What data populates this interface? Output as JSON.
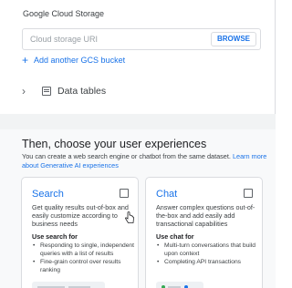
{
  "gcs": {
    "section_label": "Google Cloud Storage",
    "uri_placeholder": "Cloud storage URI",
    "browse_label": "BROWSE",
    "add_bucket_label": "Add another GCS bucket",
    "add_icon": "plus-icon"
  },
  "data_tables": {
    "label": "Data tables",
    "expand_icon": "chevron-right-icon",
    "table_icon": "table-icon"
  },
  "experiences": {
    "title": "Then, choose your user experiences",
    "description": "You can create a web search engine or chatbot from the same dataset.",
    "learn_more": "Learn more about Generative AI  experiences",
    "cards": [
      {
        "title": "Search",
        "description": "Get quality results out-of-box and easily customize according to business needs",
        "use_label": "Use search for",
        "uses": [
          "Responding to single, independent queries with a list of results",
          "Fine-grain control over results ranking"
        ],
        "checked": false
      },
      {
        "title": "Chat",
        "description": "Answer complex questions out-of-the-box and add easily add transactional capabilities",
        "use_label": "Use chat for",
        "uses": [
          "Multi-turn conversations that build upon context",
          "Completing API transactions"
        ],
        "checked": false
      }
    ]
  },
  "colors": {
    "accent": "#1a73e8",
    "text": "#202124",
    "border": "#dadce0",
    "lower_bg": "#f8f9fa"
  }
}
